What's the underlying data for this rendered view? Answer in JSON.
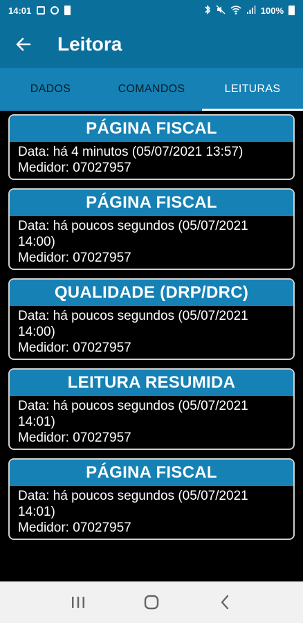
{
  "status_bar": {
    "time": "14:01",
    "battery": "100%",
    "left_icons": [
      "image-icon",
      "do-not-disturb-icon",
      "battery-saver-icon"
    ],
    "right_icons": [
      "bluetooth-icon",
      "mute-icon",
      "wifi-icon",
      "signal-icon"
    ]
  },
  "app_bar": {
    "title": "Leitora",
    "back_icon": "arrow-left-icon"
  },
  "tabs": [
    {
      "label": "DADOS",
      "active": false
    },
    {
      "label": "COMANDOS",
      "active": false
    },
    {
      "label": "LEITURAS",
      "active": true
    }
  ],
  "readings": [
    {
      "title": "PÁGINA FISCAL",
      "lines": [
        "Data: há 4 minutos (05/07/2021 13:57)",
        "Medidor: 07027957"
      ]
    },
    {
      "title": "PÁGINA FISCAL",
      "lines": [
        "Data: há poucos segundos (05/07/2021",
        "14:00)",
        "Medidor: 07027957"
      ]
    },
    {
      "title": "QUALIDADE (DRP/DRC)",
      "lines": [
        "Data: há poucos segundos (05/07/2021",
        "14:00)",
        "Medidor: 07027957"
      ]
    },
    {
      "title": "LEITURA RESUMIDA",
      "lines": [
        "Data: há poucos segundos (05/07/2021",
        "14:01)",
        "Medidor: 07027957"
      ]
    },
    {
      "title": "PÁGINA FISCAL",
      "lines": [
        "Data: há poucos segundos (05/07/2021",
        "14:01)",
        "Medidor: 07027957"
      ]
    }
  ],
  "nav_bar": {
    "icons": [
      "recent-apps-icon",
      "home-icon",
      "back-nav-icon"
    ]
  },
  "colors": {
    "app_bar": "#0b6f9c",
    "accent": "#1581b4",
    "background": "#000000"
  }
}
